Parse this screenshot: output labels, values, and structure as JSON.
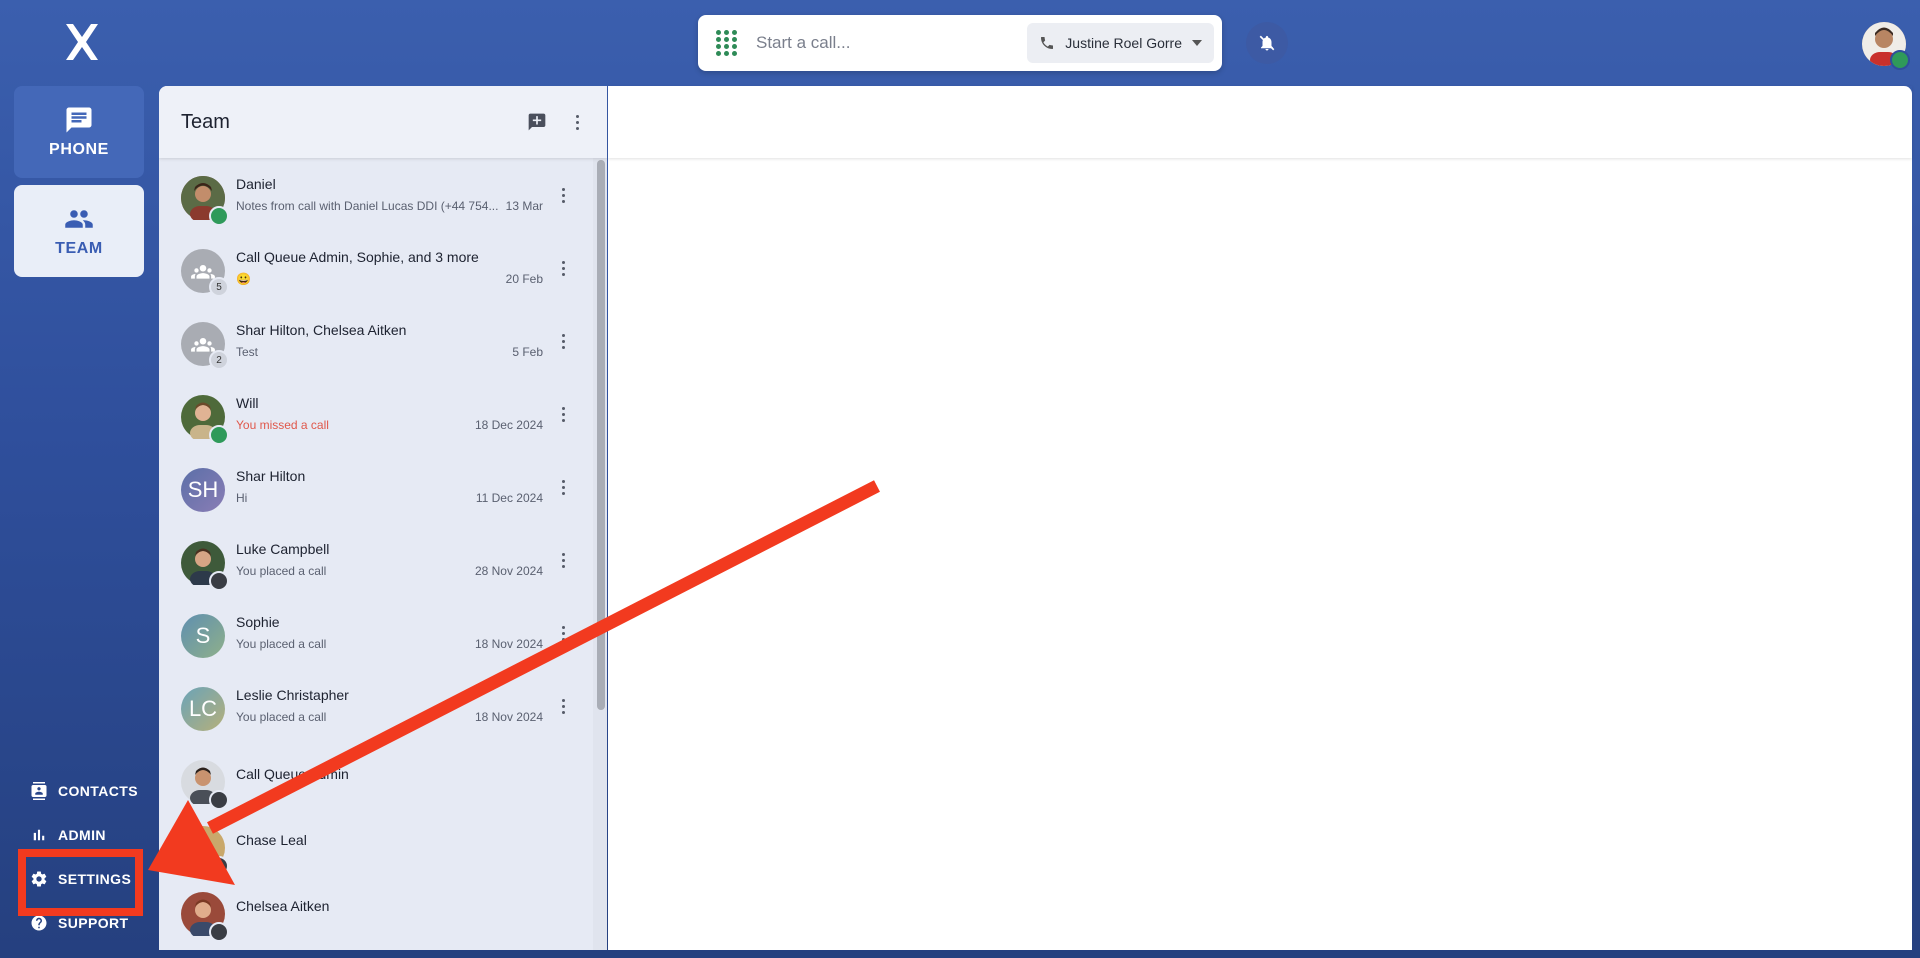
{
  "search": {
    "placeholder": "Start a call..."
  },
  "caller": {
    "name": "Justine Roel Gorre"
  },
  "nav": {
    "phone_label": "PHONE",
    "team_label": "TEAM",
    "bottom": [
      {
        "label": "CONTACTS",
        "icon": "contacts-icon"
      },
      {
        "label": "ADMIN",
        "icon": "bar-chart-icon"
      },
      {
        "label": "SETTINGS",
        "icon": "gear-icon"
      },
      {
        "label": "SUPPORT",
        "icon": "help-icon"
      }
    ]
  },
  "team": {
    "title": "Team",
    "conversations": [
      {
        "name": "Daniel",
        "preview": "Notes from call with Daniel Lucas DDI (+44 754...",
        "date": "13 Mar",
        "status": "online"
      },
      {
        "name": "Call Queue Admin, Sophie, and 3 more",
        "preview": "😀",
        "date": "20 Feb",
        "count": "5"
      },
      {
        "name": "Shar Hilton, Chelsea Aitken",
        "preview": "Test",
        "date": "5 Feb",
        "count": "2"
      },
      {
        "name": "Will",
        "preview": "You missed a call",
        "date": "18 Dec 2024",
        "status": "online"
      },
      {
        "name": "Shar Hilton",
        "initials": "SH",
        "preview": "Hi",
        "date": "11 Dec 2024"
      },
      {
        "name": "Luke Campbell",
        "preview": "You placed a call",
        "date": "28 Nov 2024",
        "status": "offline"
      },
      {
        "name": "Sophie",
        "initials": "S",
        "preview": "You placed a call",
        "date": "18 Nov 2024"
      },
      {
        "name": "Leslie Christapher",
        "initials": "LC",
        "preview": "You placed a call",
        "date": "18 Nov 2024"
      },
      {
        "name": "Call Queue Admin",
        "preview": "",
        "date": "",
        "status": "offline"
      },
      {
        "name": "Chase Leal",
        "preview": "",
        "date": "",
        "status": "offline"
      },
      {
        "name": "Chelsea Aitken",
        "preview": "",
        "date": "",
        "status": "offline"
      }
    ]
  },
  "colors": {
    "accent": "#3a5db3",
    "online": "#2f9a5a",
    "missed": "#e0584b",
    "annotation": "#f23a1f"
  }
}
